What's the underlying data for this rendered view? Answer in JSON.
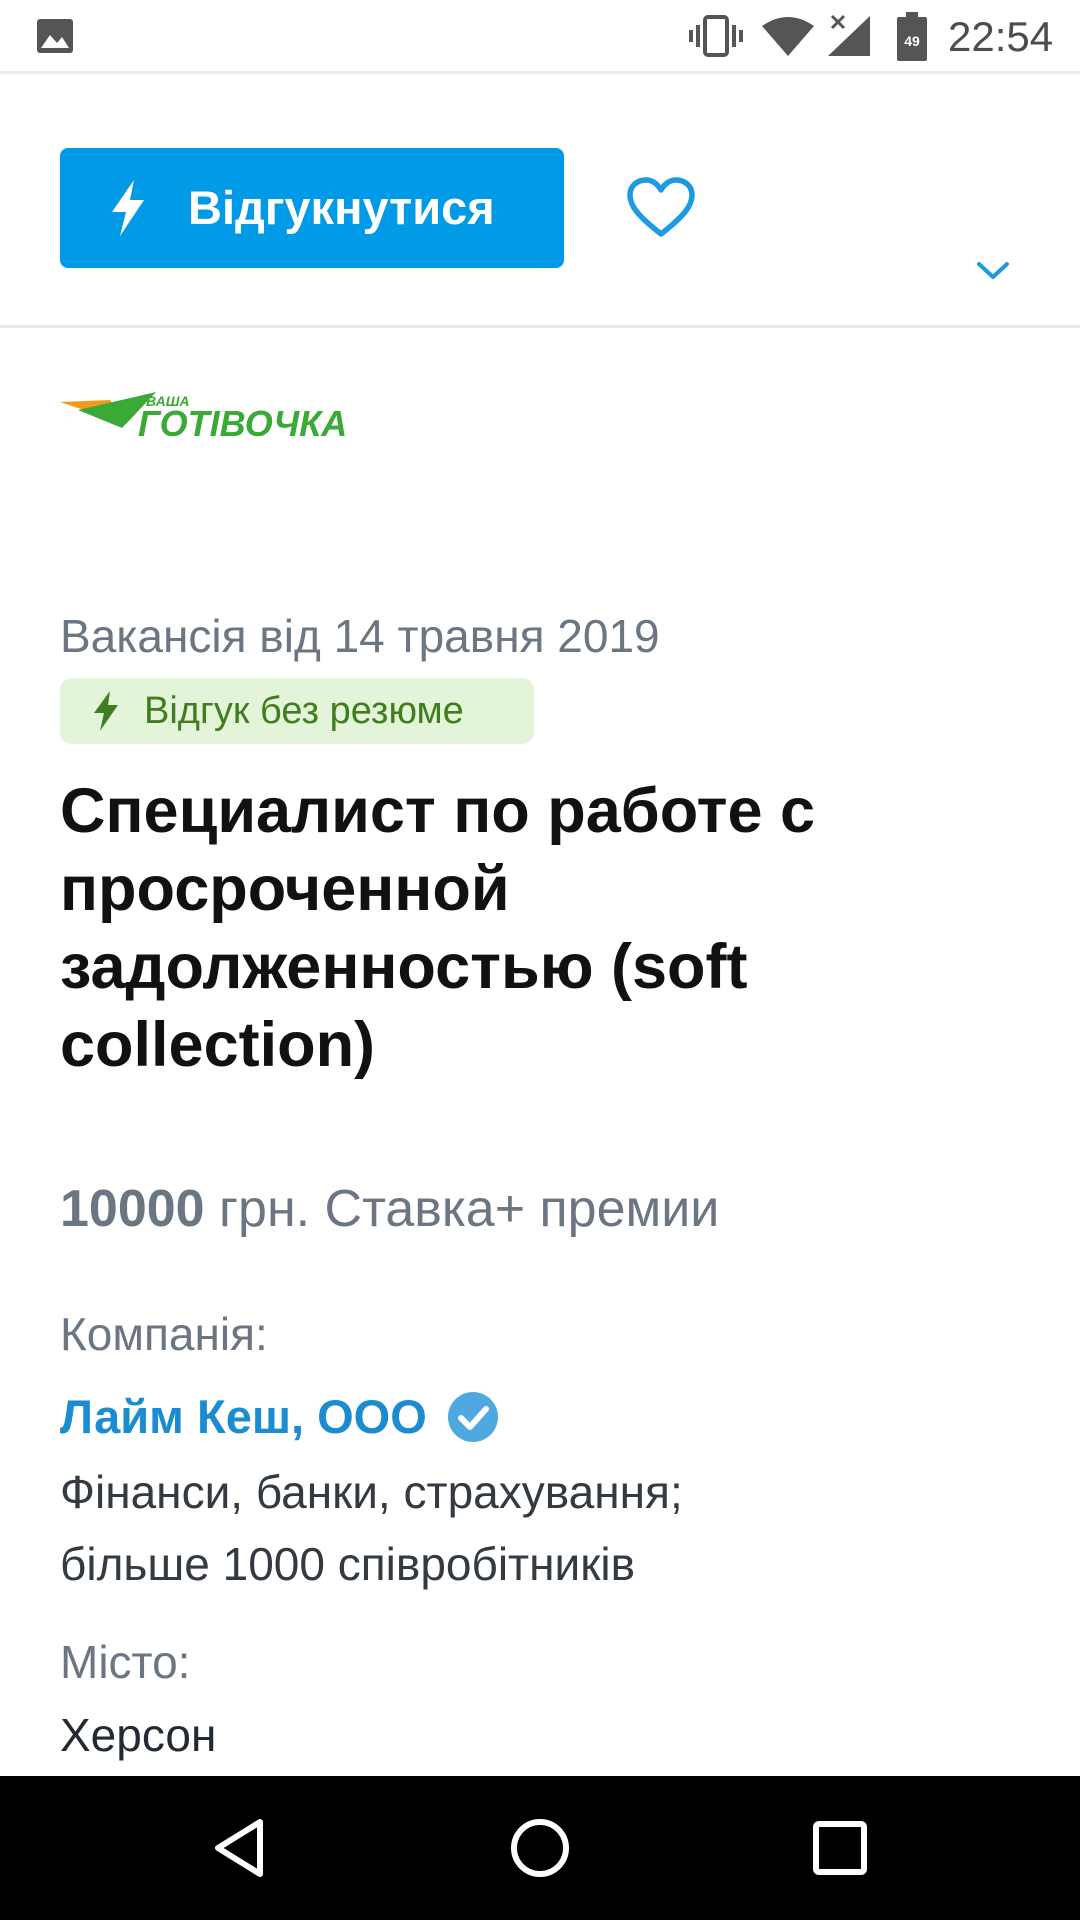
{
  "status_bar": {
    "time": "22:54",
    "battery_level": "49",
    "icons": [
      "gallery-icon",
      "vibrate-icon",
      "wifi-icon",
      "signal-icon",
      "battery-icon"
    ]
  },
  "action_bar": {
    "respond_label": "Відгукнутися",
    "respond_icon": "lightning-icon",
    "favorite_icon": "heart-icon",
    "expand_icon": "chevron-down-icon"
  },
  "vacancy": {
    "logo_small": "ВАША",
    "logo_main": "ГОТІВОЧКА",
    "posted_date": "Вакансія від 14 травня 2019",
    "no_resume_badge": "Відгук без резюме",
    "title": "Специалист по работе с просроченной задолженностью (soft collection)",
    "salary_amount": "10000",
    "salary_rest": " грн. Ставка+ премии",
    "company_label": "Компанія:",
    "company_name": "Лайм Кеш, ООО",
    "company_industry": "Фінанси, банки, страхування;",
    "company_size": "більше 1000 співробітників",
    "city_label": "Місто:",
    "city": "Херсон"
  },
  "colors": {
    "primary": "#019ae6",
    "link": "#1a8ccf",
    "badge_bg": "#e3f4d8",
    "badge_text": "#3f7d20",
    "muted_text": "#6b7682",
    "logo_green": "#3aa935",
    "logo_orange": "#f39a1e"
  }
}
